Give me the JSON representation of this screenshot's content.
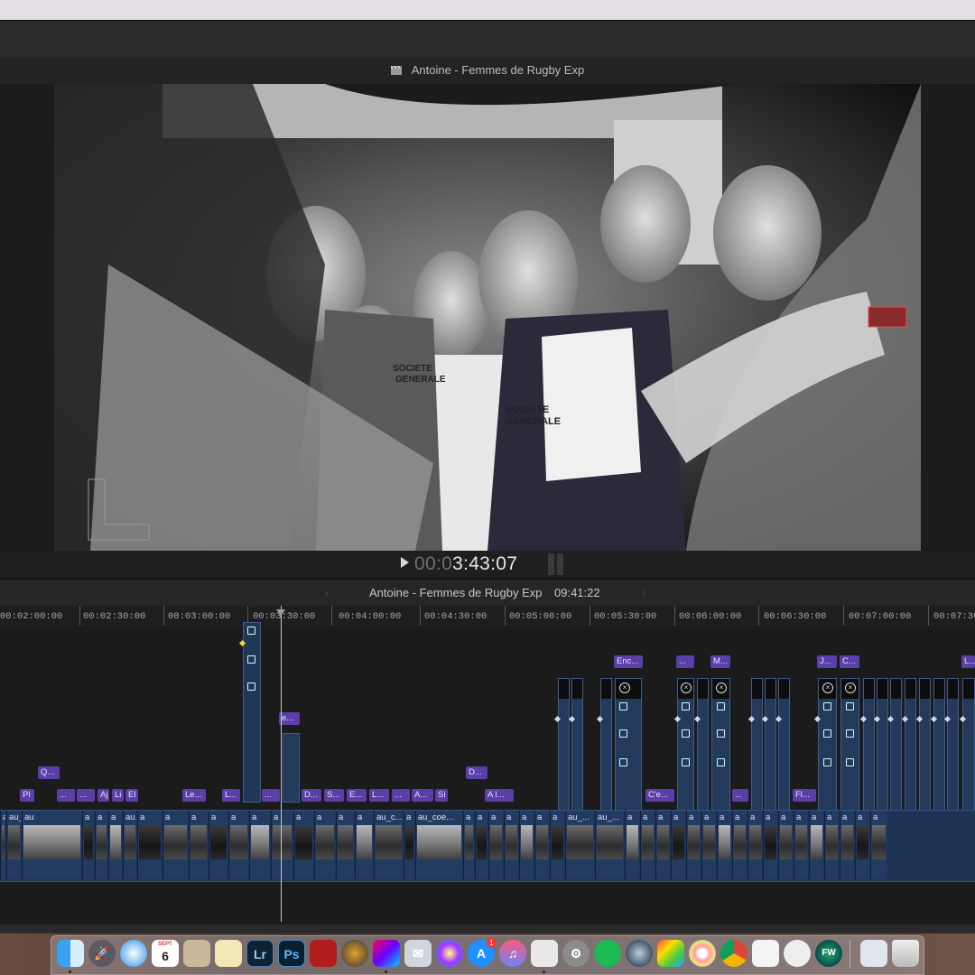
{
  "viewer": {
    "title": "Antoine - Femmes de Rugby Exp",
    "timecode_dim": "00:0",
    "timecode_main": "3:43:07"
  },
  "timeline": {
    "project_name": "Antoine - Femmes de Rugby Exp",
    "duration": "09:41:22",
    "prev_arrow": "‹",
    "next_arrow": "›",
    "ruler": [
      "00:02:00:00",
      "00:02:30:00",
      "00:03:00:00",
      "00:03:30:00",
      "00:04:00:00",
      "00:04:30:00",
      "00:05:00:00",
      "00:05:30:00",
      "00:06:00:00",
      "00:06:30:00",
      "00:07:00:00",
      "00:07:30"
    ],
    "title_labels": [
      "Q...",
      "D...",
      "Pl",
      "...",
      "...",
      "Aj",
      "Li",
      "El",
      "Le...",
      "L...",
      "...",
      "D...",
      "S...",
      "E...",
      "L...",
      "...",
      "A...",
      "Si",
      "A l...",
      "Enc...",
      "...",
      "M...",
      "J...",
      "C...",
      "L...",
      "C'e...",
      "...",
      "Fl...",
      "e..."
    ],
    "clips": [
      "a",
      "au_coeur_...",
      "au",
      "a",
      "a",
      "a",
      "au...",
      "a",
      "a",
      "a",
      "a",
      "a",
      "a",
      "a",
      "a",
      "a",
      "a",
      "a",
      "au_c...",
      "a",
      "au_coe...",
      "a",
      "a",
      "a",
      "a",
      "a",
      "a",
      "a",
      "au_...",
      "au_...",
      "a",
      "a",
      "a",
      "a",
      "a",
      "a",
      "a",
      "a",
      "a",
      "a",
      "a",
      "a",
      "a",
      "a",
      "a",
      "a",
      "a"
    ]
  },
  "dock": {
    "apps": [
      "Finder",
      "Launchpad",
      "Safari",
      "Calendar",
      "Notes",
      "Lightroom",
      "Photoshop",
      "Photo Booth",
      "DaVinci Resolve",
      "Final Cut Pro",
      "Mail",
      "Motion",
      "App Store",
      "iTunes",
      "Preview",
      "System Preferences",
      "Spotify",
      "QuickTime",
      "Colors",
      "Photos",
      "Chrome",
      "TextEdit",
      "Evernote",
      "Fetch",
      "Documents",
      "Trash"
    ],
    "calendar_month": "SEPT",
    "calendar_day": "6",
    "appstore_badge": "1",
    "lr": "Lr",
    "ps": "Ps",
    "fw": "FW"
  }
}
